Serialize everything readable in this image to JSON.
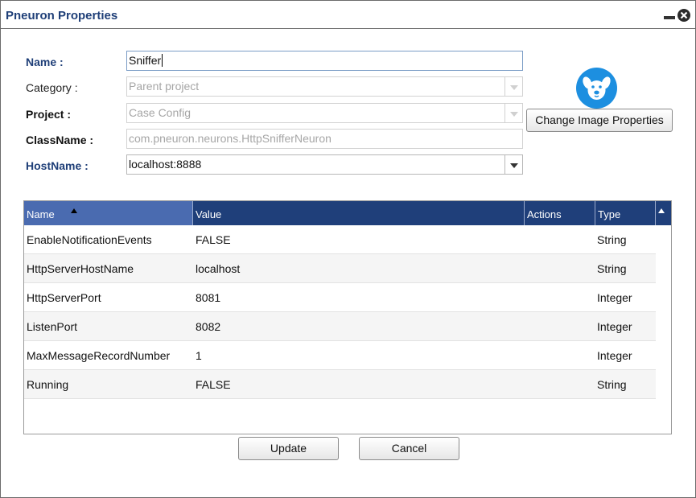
{
  "dialog": {
    "title": "Pneuron Properties",
    "minimize_icon": "minimize-icon",
    "close_icon": "close-circle-icon"
  },
  "form": {
    "name": {
      "label": "Name :",
      "value": "Sniffer"
    },
    "category": {
      "label": "Category :",
      "value": "Parent project"
    },
    "project": {
      "label": "Project :",
      "value": "Case Config"
    },
    "classname": {
      "label": "ClassName :",
      "value": "com.pneuron.neurons.HttpSnifferNeuron"
    },
    "hostname": {
      "label": "HostName :",
      "value": "localhost:8888"
    }
  },
  "image": {
    "icon": "dog-face-icon",
    "button_label": "Change Image Properties"
  },
  "grid": {
    "columns": [
      "Name",
      "Value",
      "Actions",
      "Type"
    ],
    "sort_column": "Name",
    "sort_direction": "ascending",
    "rows": [
      {
        "name": "EnableNotificationEvents",
        "value": "FALSE",
        "actions": "",
        "type": "String"
      },
      {
        "name": "HttpServerHostName",
        "value": "localhost",
        "actions": "",
        "type": "String"
      },
      {
        "name": "HttpServerPort",
        "value": "8081",
        "actions": "",
        "type": "Integer"
      },
      {
        "name": "ListenPort",
        "value": "8082",
        "actions": "",
        "type": "Integer"
      },
      {
        "name": "MaxMessageRecordNumber",
        "value": "1",
        "actions": "",
        "type": "Integer"
      },
      {
        "name": "Running",
        "value": "FALSE",
        "actions": "",
        "type": "String"
      }
    ]
  },
  "buttons": {
    "update": "Update",
    "cancel": "Cancel"
  },
  "colors": {
    "title": "#1f3f78",
    "header_bg": "#1f3f7a",
    "header_sorted_bg": "#4a6bb0",
    "avatar_bg": "#1d8fe0"
  }
}
